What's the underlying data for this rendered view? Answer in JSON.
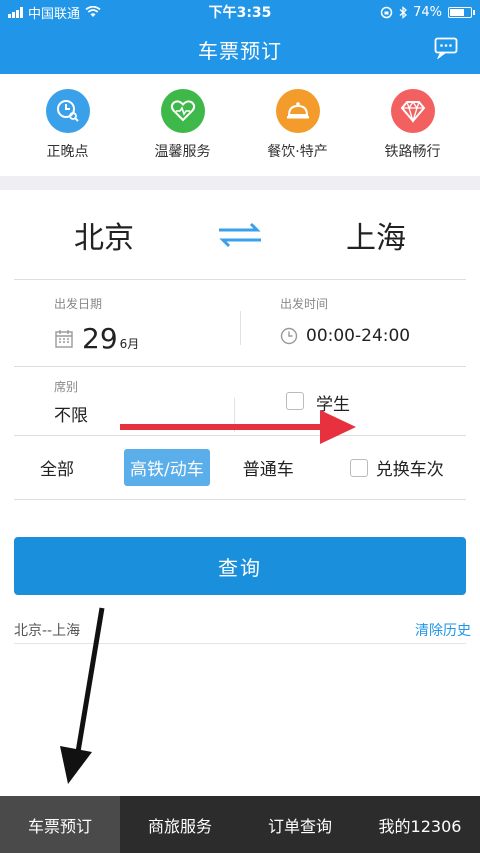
{
  "status_bar": {
    "carrier": "中国联通",
    "time": "下午3:35",
    "battery": "74%",
    "battery_level": 0.74
  },
  "header": {
    "title": "车票预订"
  },
  "services": [
    {
      "label": "正晚点",
      "icon": "clock-search-icon",
      "color": "#3aa0ea"
    },
    {
      "label": "温馨服务",
      "icon": "heart-care-icon",
      "color": "#3fb84a"
    },
    {
      "label": "餐饮·特产",
      "icon": "food-dome-icon",
      "color": "#f39b2b"
    },
    {
      "label": "铁路畅行",
      "icon": "diamond-icon",
      "color": "#f26060"
    }
  ],
  "route": {
    "from": "北京",
    "to": "上海"
  },
  "departure": {
    "date_label": "出发日期",
    "day": "29",
    "month": "6月",
    "time_label": "出发时间",
    "time_value": "00:00-24:00"
  },
  "seat": {
    "label": "席别",
    "value": "不限",
    "student_label": "学生"
  },
  "train_types": {
    "all": "全部",
    "high_speed": "高铁/动车",
    "normal": "普通车",
    "swap_label": "兑换车次"
  },
  "query_button": "查询",
  "history": {
    "route": "北京--上海",
    "clear": "清除历史"
  },
  "tabs": [
    "车票预订",
    "商旅服务",
    "订单查询",
    "我的12306"
  ],
  "colors": {
    "primary": "#2196e8",
    "button": "#1a8fdc",
    "tabbar": "#2c2c2c",
    "arrow_red": "#e8313f"
  }
}
